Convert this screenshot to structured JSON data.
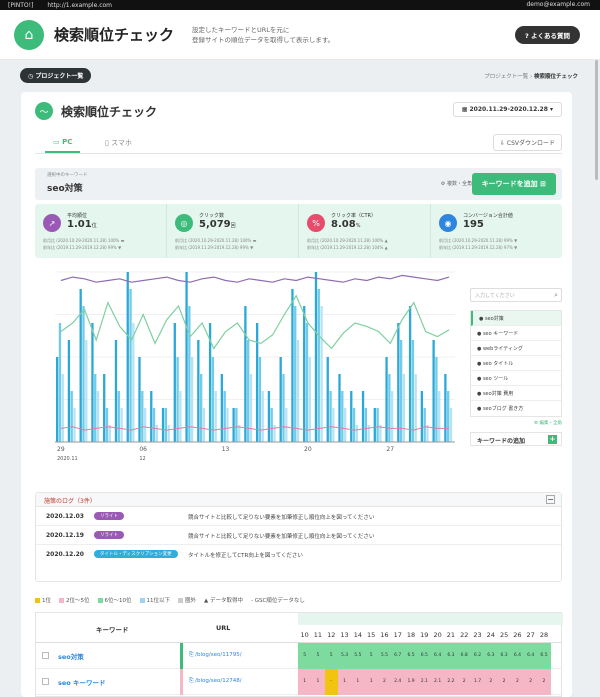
{
  "browser": {
    "tab": "[PINTO!]",
    "url": "http://1.example.com",
    "user": "demo@example.com"
  },
  "header": {
    "title": "検索順位チェック",
    "desc_line1": "設定したキーワードとURLを元に",
    "desc_line2": "登録サイトの順位データを取得して表示します。",
    "faq": "よくある質問"
  },
  "nav": {
    "projects_button": "プロジェクト一覧",
    "crumb_link": "プロジェクト一覧",
    "crumb_current": "検索順位チェック"
  },
  "card": {
    "title": "検索順位チェック",
    "date_range": "2020.11.29-2020.12.28"
  },
  "tabs": [
    {
      "label": "PC"
    },
    {
      "label": "スマホ"
    }
  ],
  "csv_button": "CSVダウンロード",
  "keyword": {
    "label": "選択中のキーワード",
    "value": "seo対策",
    "edit": "複数・全角",
    "add_button": "キーワードを追加"
  },
  "metrics": [
    {
      "label": "平均順位",
      "value": "1.01",
      "unit": "位",
      "sub1": "前月比 (2020.10.29-2020.11.28) 100% ▬",
      "sub2": "前年比 (2019.11.29-2019.12.28) 99% ▼",
      "color": "#9b59b6"
    },
    {
      "label": "クリック数",
      "value": "5,079",
      "unit": "回",
      "sub1": "前月比 (2020.10.29-2020.11.28) 100% ▬",
      "sub2": "前年比 (2019.11.29-2019.12.28) 99% ▼",
      "color": "#3dbb7a"
    },
    {
      "label": "クリック率（CTR）",
      "value": "8.08",
      "unit": "%",
      "sub1": "前月比 (2020.10.29-2020.11.28) 100% ▲",
      "sub2": "前年比 (2019.11.29-2019.12.28) 104% ▲",
      "color": "#e74c6c"
    },
    {
      "label": "コンバージョン合計値",
      "value": "195",
      "unit": "",
      "sub1": "前月比 (2020.10.29-2020.11.28) 99% ▼",
      "sub2": "前年比 (2019.11.29-2019.12.28) 97% ▼",
      "color": "#2e86de"
    }
  ],
  "side": {
    "search_placeholder": "入力してください",
    "items": [
      "seo対策",
      "seo キーワード",
      "webライティング",
      "seo タイトル",
      "seo ツール",
      "seo対策 費用",
      "seoブログ 書き方"
    ],
    "edit": "編集・全角",
    "add_keyword": "キーワードの追加"
  },
  "chart_data": {
    "type": "bar",
    "x_ticks": [
      "29",
      "06",
      "13",
      "20",
      "27"
    ],
    "x_sub": [
      "2020.11",
      "12"
    ],
    "bars": [
      [
        5,
        7,
        4
      ],
      [
        6,
        3,
        2
      ],
      [
        9,
        8,
        6
      ],
      [
        7,
        4,
        3
      ],
      [
        4,
        2,
        1
      ],
      [
        6,
        3,
        2
      ],
      [
        10,
        9,
        7
      ],
      [
        5,
        3,
        2
      ],
      [
        3,
        2,
        1
      ],
      [
        2,
        2,
        1
      ],
      [
        7,
        5,
        3
      ],
      [
        10,
        8,
        5
      ],
      [
        6,
        4,
        2
      ],
      [
        7,
        5,
        3
      ],
      [
        4,
        3,
        2
      ],
      [
        2,
        2,
        1
      ],
      [
        8,
        6,
        4
      ],
      [
        7,
        5,
        3
      ],
      [
        3,
        2,
        1
      ],
      [
        5,
        4,
        2
      ],
      [
        9,
        8,
        6
      ],
      [
        8,
        7,
        5
      ],
      [
        10,
        9,
        8
      ],
      [
        5,
        3,
        2
      ],
      [
        4,
        3,
        2
      ],
      [
        3,
        2,
        1
      ],
      [
        3,
        2,
        1
      ],
      [
        2,
        2,
        1
      ],
      [
        5,
        4,
        3
      ],
      [
        7,
        6,
        4
      ],
      [
        8,
        6,
        4
      ],
      [
        3,
        2,
        1
      ],
      [
        6,
        5,
        3
      ],
      [
        4,
        3,
        2
      ]
    ],
    "ctr_line": [
      9.5,
      9.7,
      9.6,
      9.4,
      9.5,
      9.6,
      9.4,
      9.5,
      9.6,
      9.7,
      9.5,
      9.4,
      9.6,
      9.7,
      9.5,
      9.4,
      9.6,
      9.5,
      9.4,
      9.6,
      9.5,
      9.7,
      9.6,
      9.5,
      9.4,
      9.6,
      9.5,
      9.7,
      9.6,
      9.8,
      9.7,
      9.6,
      9.5,
      9.7
    ],
    "avg_line": [
      6.5,
      7,
      7.8,
      6,
      8.2,
      6.8,
      6,
      7.5,
      5.8,
      7.2,
      8,
      6.2,
      7,
      5.5,
      6.5,
      7,
      6,
      5.8,
      6.3,
      7.5,
      8.6,
      7,
      6.2,
      5.5,
      6.4,
      7,
      6.8,
      6.5,
      5.8,
      7.2,
      8.2,
      6.5,
      6.2,
      6.6
    ],
    "pink_line": [
      0.8,
      0.9,
      0.7,
      0.8,
      0.9,
      0.8,
      0.7,
      0.9,
      0.8,
      0.7,
      0.8,
      0.9,
      0.8,
      0.7,
      0.8,
      0.9,
      0.8,
      0.7,
      0.8,
      0.9,
      0.8,
      0.7,
      0.8,
      0.9,
      0.8,
      0.7,
      0.8,
      0.9,
      0.8,
      0.8,
      0.7,
      0.9,
      0.8,
      0.8
    ],
    "ylim": [
      0,
      10
    ]
  },
  "log": {
    "title": "施策のログ（3件）",
    "rows": [
      {
        "date": "2020.12.03",
        "tag": "リライト",
        "tag_color": "#9b59b6",
        "text": "競合サイトと比較して足りない要素を加筆修正し順位向上を図ってください"
      },
      {
        "date": "2020.12.19",
        "tag": "リライト",
        "tag_color": "#9b59b6",
        "text": "競合サイトと比較して足りない要素を加筆修正し順位向上を図ってください"
      },
      {
        "date": "2020.12.20",
        "tag": "タイトル・ディスクリプション変更",
        "tag_color": "#2eb0d6",
        "text": "タイトルを修正してCTR向上を図ってください"
      }
    ]
  },
  "legend": [
    {
      "label": "1位",
      "color": "#f1c40f"
    },
    {
      "label": "2位〜5位",
      "color": "#f5b7c5"
    },
    {
      "label": "6位〜10位",
      "color": "#7ddba0"
    },
    {
      "label": "11位以下",
      "color": "#9fd3ef"
    },
    {
      "label": "圏外",
      "color": "#cccccc"
    },
    {
      "label": "データ取得中",
      "color": ""
    },
    {
      "label": "GSC順位データなし",
      "color": ""
    }
  ],
  "table": {
    "col_keyword": "キーワード",
    "col_url": "URL",
    "days": [
      "10",
      "11",
      "12",
      "13",
      "14",
      "15",
      "16",
      "17",
      "18",
      "19",
      "20",
      "21",
      "22",
      "23",
      "24",
      "25",
      "26",
      "27",
      "28"
    ],
    "rows": [
      {
        "keyword": "seo対策",
        "url": "/blog/seo/11795/",
        "color": "#7ddba0",
        "ranks": [
          "5",
          "5",
          "5",
          "5.3",
          "5.5",
          "5",
          "5.5",
          "6.7",
          "6.5",
          "6.5",
          "6.4",
          "6.3",
          "6.8",
          "6.2",
          "6.3",
          "6.3",
          "6.4",
          "6.4",
          "6.5"
        ]
      },
      {
        "keyword": "seo キーワード",
        "url": "/blog/seo/12748/",
        "color": "#f5b7c5",
        "ranks": [
          "1",
          "1",
          "-",
          "1",
          "1",
          "1",
          "2",
          "2.4",
          "1.9",
          "2.1",
          "2.1",
          "2.2",
          "2",
          "1.7",
          "2",
          "2",
          "2",
          "2",
          "2"
        ]
      }
    ]
  }
}
